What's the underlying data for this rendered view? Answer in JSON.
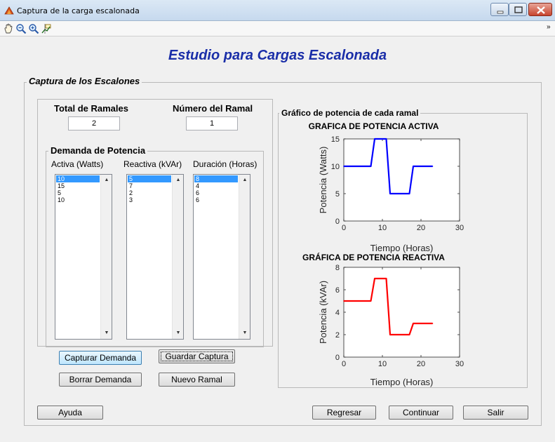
{
  "window": {
    "title": "Captura de la carga escalonada"
  },
  "toolbar": {
    "tools": [
      "pan-icon",
      "zoom-in-icon",
      "zoom-in-plus-icon",
      "data-cursor-icon"
    ],
    "overflow": "»"
  },
  "page": {
    "title": "Estudio para Cargas Escalonada"
  },
  "capture_panel": {
    "title": "Captura de los Escalones",
    "total_ramales_label": "Total de Ramales",
    "total_ramales_value": "2",
    "numero_ramal_label": "Número del Ramal",
    "numero_ramal_value": "1"
  },
  "demanda_panel": {
    "title": "Demanda de Potencia",
    "col_activa": "Activa  (Watts)",
    "col_reactiva": "Reactiva (kVAr)",
    "col_duracion": "Duración (Horas)",
    "activa": [
      "10",
      "15",
      "5",
      "10"
    ],
    "reactiva": [
      "5",
      "7",
      "2",
      "3"
    ],
    "duracion": [
      "8",
      "4",
      "6",
      "6"
    ]
  },
  "buttons": {
    "capturar": "Capturar Demanda",
    "guardar": "Guardar Captura",
    "borrar": "Borrar Demanda",
    "nuevo": "Nuevo Ramal",
    "ayuda": "Ayuda",
    "regresar": "Regresar",
    "continuar": "Continuar",
    "salir": "Salir"
  },
  "graph_panel": {
    "title": "Gráfico de potencia de cada ramal"
  },
  "colors": {
    "activa": "#0000ff",
    "reactiva": "#ff0000",
    "title_blue": "#1a2ea8"
  },
  "chart_data": [
    {
      "type": "line",
      "title": "GRAFICA DE POTENCIA ACTIVA",
      "xlabel": "Tiempo (Horas)",
      "ylabel": "Potencia (Watts)",
      "xlim": [
        0,
        30
      ],
      "ylim": [
        0,
        15
      ],
      "xticks": [
        "0",
        "10",
        "20",
        "30"
      ],
      "yticks": [
        "0",
        "5",
        "10",
        "15"
      ],
      "color": "#0000ff",
      "x": [
        0,
        7,
        8,
        11,
        12,
        17,
        18,
        23
      ],
      "y": [
        10,
        10,
        15,
        15,
        5,
        5,
        10,
        10
      ]
    },
    {
      "type": "line",
      "title": "GRÁFICA DE POTENCIA REACTIVA",
      "xlabel": "Tiempo (Horas)",
      "ylabel": "Potencia (kVAr)",
      "xlim": [
        0,
        30
      ],
      "ylim": [
        0,
        8
      ],
      "xticks": [
        "0",
        "10",
        "20",
        "30"
      ],
      "yticks": [
        "0",
        "2",
        "4",
        "6",
        "8"
      ],
      "color": "#ff0000",
      "x": [
        0,
        7,
        8,
        11,
        12,
        17,
        18,
        23
      ],
      "y": [
        5,
        5,
        7,
        7,
        2,
        2,
        3,
        3
      ]
    }
  ]
}
